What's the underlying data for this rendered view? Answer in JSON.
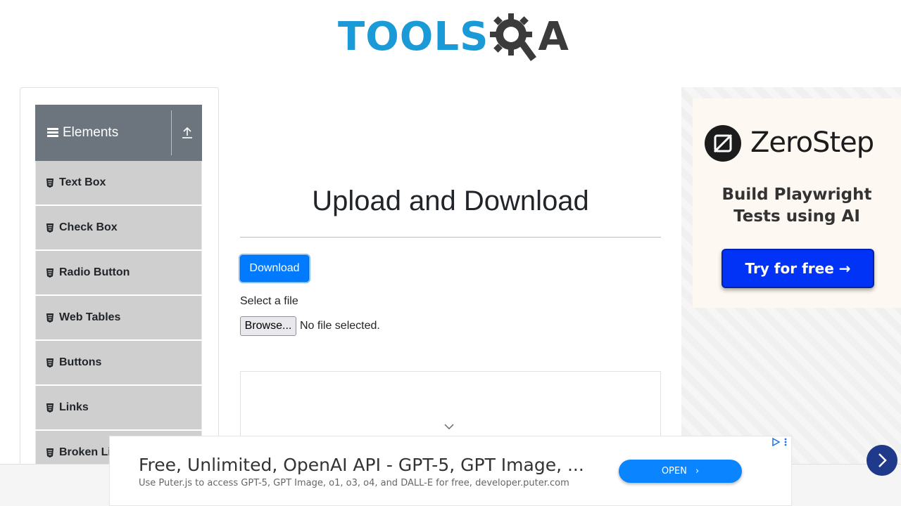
{
  "header": {
    "logo_tools": "TOOLS",
    "logo_qa": "A"
  },
  "sidebar": {
    "group": {
      "title": "Elements",
      "toggle_icon": "upload-arrow-icon"
    },
    "items": [
      {
        "label": "Text Box",
        "icon": "doc-icon"
      },
      {
        "label": "Check Box",
        "icon": "doc-icon"
      },
      {
        "label": "Radio Button",
        "icon": "doc-icon"
      },
      {
        "label": "Web Tables",
        "icon": "doc-icon"
      },
      {
        "label": "Buttons",
        "icon": "doc-icon"
      },
      {
        "label": "Links",
        "icon": "doc-icon"
      },
      {
        "label": "Broken Links - Images",
        "icon": "doc-icon"
      }
    ]
  },
  "main": {
    "title": "Upload and Download",
    "download_label": "Download",
    "select_label": "Select a file",
    "browse_label": "Browse...",
    "file_status": "No file selected."
  },
  "ad_right": {
    "brand": "ZeroStep",
    "tagline_line1": "Build Playwright",
    "tagline_line2": "Tests using AI",
    "cta": "Try for free →"
  },
  "bottom_ad": {
    "title": "Free, Unlimited, OpenAI API - GPT-5, GPT Image, ...",
    "subtitle": "Use Puter.js to access GPT-5, GPT Image, o1, o3, o4, and DALL-E for free, developer.puter.com",
    "open_label": "OPEN"
  },
  "colors": {
    "brand_blue": "#1a9ad6",
    "primary_button": "#007bff",
    "sidebar_header": "#6c757d",
    "menu_item_bg": "#cfcfcf",
    "cta_blue": "#0033f5"
  }
}
